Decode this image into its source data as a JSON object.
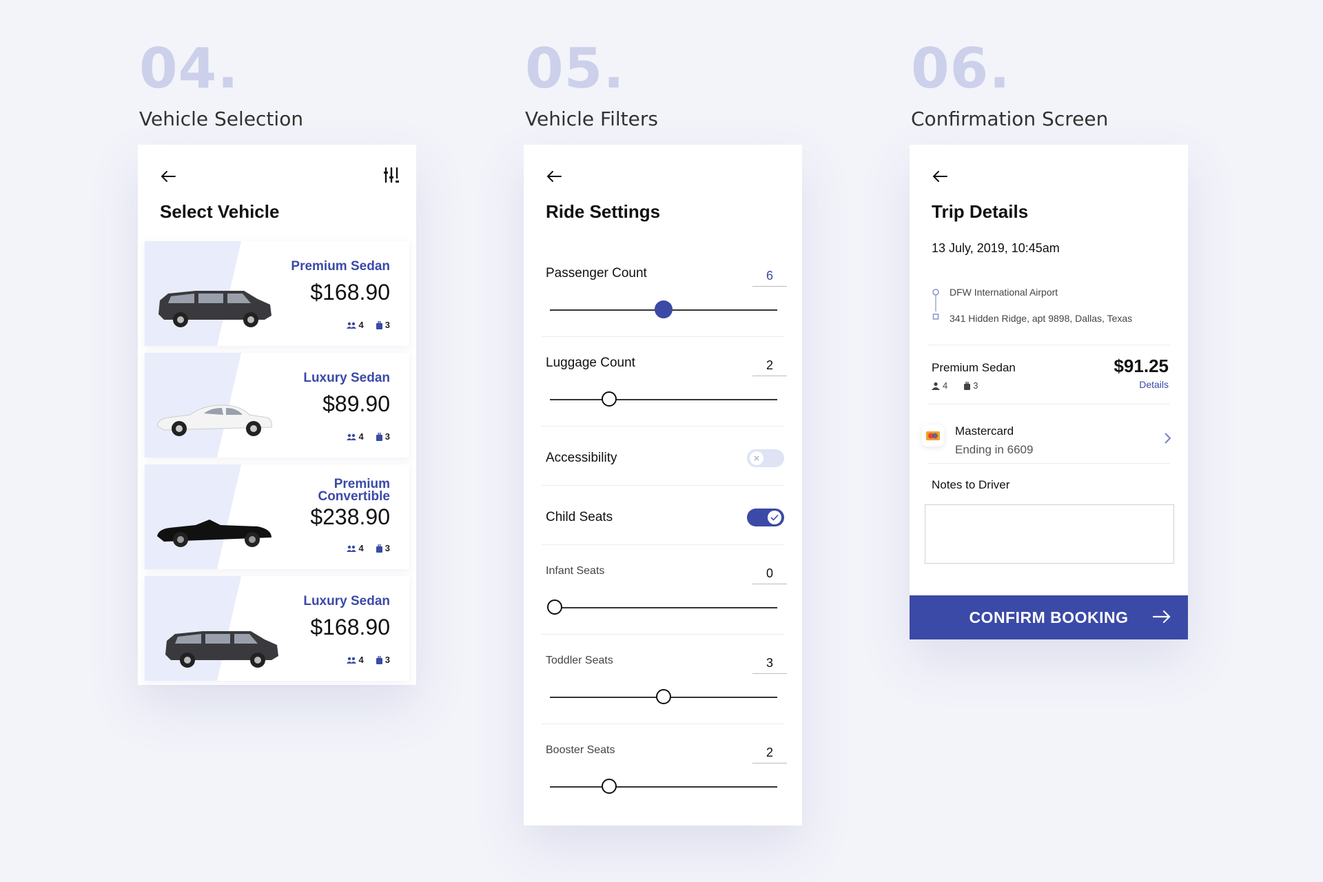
{
  "sections": [
    {
      "number": "04.",
      "label": "Vehicle Selection"
    },
    {
      "number": "05.",
      "label": "Vehicle Filters"
    },
    {
      "number": "06.",
      "label": "Confirmation Screen"
    }
  ],
  "vehicle_selection": {
    "title": "Select Vehicle",
    "icons": {
      "back": "back-arrow-icon",
      "filter": "filter-sliders-icon"
    },
    "vehicles": [
      {
        "name_line1": "Premium Sedan",
        "name_line2": "",
        "price": "$168.90",
        "passengers": "4",
        "luggage": "3",
        "car_color": "#3a3a3e"
      },
      {
        "name_line1": "Luxury Sedan",
        "name_line2": "",
        "price": "$89.90",
        "passengers": "4",
        "luggage": "3",
        "car_color": "#f4f4f4"
      },
      {
        "name_line1": "Premium",
        "name_line2": "Convertible",
        "price": "$238.90",
        "passengers": "4",
        "luggage": "3",
        "car_color": "#111111"
      },
      {
        "name_line1": "Luxury Sedan",
        "name_line2": "",
        "price": "$168.90",
        "passengers": "4",
        "luggage": "3",
        "car_color": "#3a3a3e"
      }
    ]
  },
  "vehicle_filters": {
    "title": "Ride Settings",
    "passenger_count": {
      "label": "Passenger Count",
      "value": "6",
      "fraction": 0.5
    },
    "luggage_count": {
      "label": "Luggage Count",
      "value": "2",
      "fraction": 0.26
    },
    "accessibility": {
      "label": "Accessibility",
      "enabled": false
    },
    "child_seats": {
      "label": "Child Seats",
      "enabled": true
    },
    "infant_seats": {
      "label": "Infant Seats",
      "value": "0",
      "fraction": 0.02
    },
    "toddler_seats": {
      "label": "Toddler Seats",
      "value": "3",
      "fraction": 0.5
    },
    "booster_seats": {
      "label": "Booster Seats",
      "value": "2",
      "fraction": 0.26
    }
  },
  "confirmation": {
    "title": "Trip Details",
    "date": "13 July, 2019, 10:45am",
    "pickup": "DFW International Airport",
    "dropoff": "341 Hidden Ridge, apt 9898, Dallas, Texas",
    "vehicle": "Premium Sedan",
    "passengers": "4",
    "luggage": "3",
    "price": "$91.25",
    "details_link": "Details",
    "payment": {
      "name": "Mastercard",
      "sub": "Ending in 6609"
    },
    "notes_label": "Notes to Driver",
    "notes_value": "",
    "confirm_label": "CONFIRM BOOKING"
  },
  "colors": {
    "accent": "#3b4aa6",
    "card_shape": "#e9ecfa",
    "background": "#f3f4fa"
  }
}
